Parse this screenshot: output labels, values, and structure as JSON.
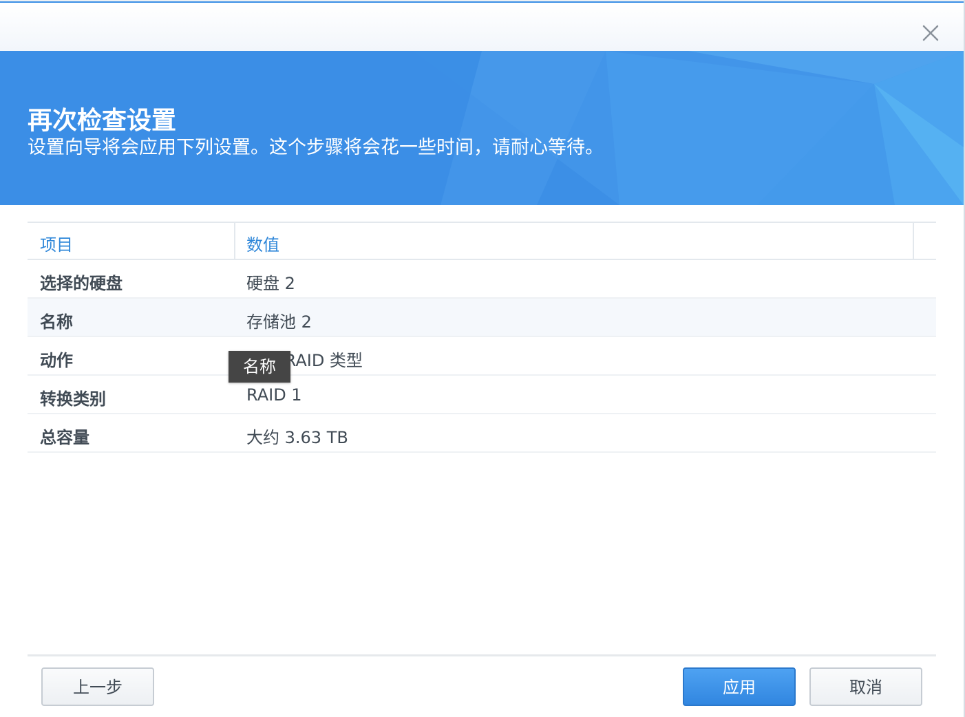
{
  "header": {
    "title": "再次检查设置",
    "subtitle": "设置向导将会应用下列设置。这个步骤将会花一些时间，请耐心等待。"
  },
  "table": {
    "columns": [
      "项目",
      "数值"
    ],
    "rows": [
      {
        "key": "选择的硬盘",
        "value": "硬盘 2"
      },
      {
        "key": "名称",
        "value": "存储池 2"
      },
      {
        "key": "动作",
        "value": "更改 RAID 类型"
      },
      {
        "key": "转换类别",
        "value": "RAID 1"
      },
      {
        "key": "总容量",
        "value": "大约 3.63 TB"
      }
    ]
  },
  "tooltip": {
    "text": "名称"
  },
  "buttons": {
    "back": "上一步",
    "apply": "应用",
    "cancel": "取消"
  },
  "icons": {
    "close": "close-icon"
  },
  "colors": {
    "banner": "#3a8ee6",
    "header_text": "#2f87d9",
    "primary_button": "#3186e0",
    "body_text": "#414b55"
  }
}
